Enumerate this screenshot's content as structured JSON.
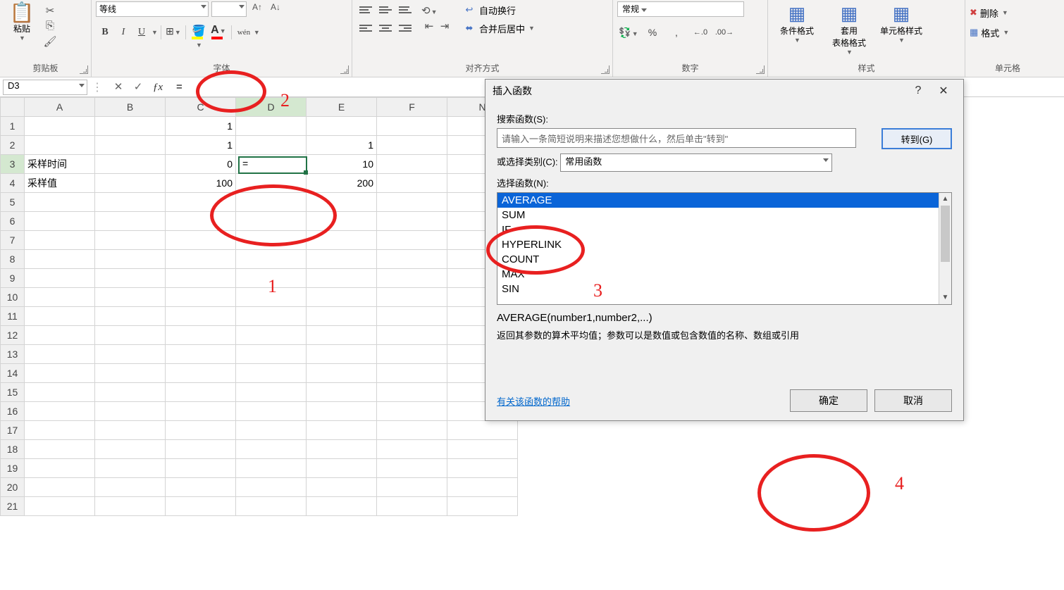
{
  "ribbon": {
    "clipboard": {
      "label": "剪贴板",
      "paste": "粘贴"
    },
    "font": {
      "label": "字体",
      "name": "等线",
      "bold": "B",
      "italic": "I",
      "underline": "U",
      "ruby": "wén"
    },
    "alignment": {
      "label": "对齐方式",
      "wrap": "自动换行",
      "merge": "合并后居中"
    },
    "number": {
      "label": "数字",
      "format": "常规",
      "inc_dec": ".0",
      "dec_dec": ".00"
    },
    "styles": {
      "label": "样式",
      "cond": "条件格式",
      "table": "套用\n表格格式",
      "cell": "单元格样式"
    },
    "cells": {
      "label": "单元格",
      "delete": "删除",
      "format": "格式"
    }
  },
  "formula_bar": {
    "name_box": "D3",
    "value": "="
  },
  "sheet": {
    "cols": [
      "A",
      "B",
      "C",
      "D",
      "E",
      "F",
      "N"
    ],
    "rows": 21,
    "cells": {
      "r1": {
        "C": "1"
      },
      "r2": {
        "C": "1",
        "E": "1"
      },
      "r3": {
        "A": "采样时间",
        "C": "0",
        "D": "=",
        "E": "10"
      },
      "r4": {
        "A": "采样值",
        "C": "100",
        "E": "200"
      }
    },
    "active": "D3"
  },
  "dialog": {
    "title": "插入函数",
    "search_label": "搜索函数(S):",
    "search_placeholder": "请输入一条简短说明来描述您想做什么，然后单击\"转到\"",
    "go": "转到(G)",
    "category_label": "或选择类别(C):",
    "category_value": "常用函数",
    "select_label": "选择函数(N):",
    "functions": [
      "AVERAGE",
      "SUM",
      "IF",
      "HYPERLINK",
      "COUNT",
      "MAX",
      "SIN"
    ],
    "selected": "AVERAGE",
    "signature": "AVERAGE(number1,number2,...)",
    "description": "返回其参数的算术平均值；参数可以是数值或包含数值的名称、数组或引用",
    "help_link": "有关该函数的帮助",
    "ok": "确定",
    "cancel": "取消"
  },
  "annotations": {
    "n1": "1",
    "n2": "2",
    "n3": "3",
    "n4": "4"
  }
}
